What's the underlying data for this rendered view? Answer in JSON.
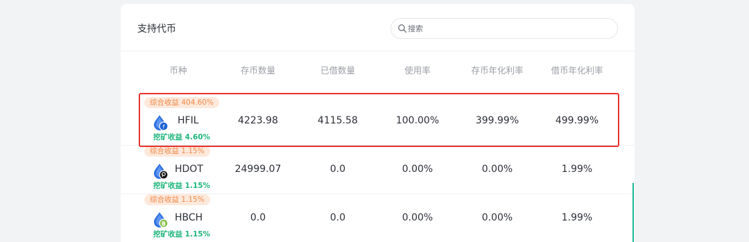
{
  "title": "支持代币",
  "search": {
    "placeholder": "搜索"
  },
  "table": {
    "headers": [
      "币种",
      "存币数量",
      "已借数量",
      "使用率",
      "存币年化利率",
      "借币年化利率"
    ],
    "rows": [
      {
        "total_yield": "综合收益 404.60%",
        "coin": "HFIL",
        "icon": "filecoin-icon",
        "mining_yield": "挖矿收益 4.60%",
        "deposited": "4223.98",
        "borrowed": "4115.58",
        "utilization": "100.00%",
        "deposit_apy": "399.99%",
        "borrow_apy": "499.99%"
      },
      {
        "total_yield": "综合收益 1.15%",
        "coin": "HDOT",
        "icon": "polkadot-icon",
        "mining_yield": "挖矿收益 1.15%",
        "deposited": "24999.07",
        "borrowed": "0.0",
        "utilization": "0.00%",
        "deposit_apy": "0.00%",
        "borrow_apy": "1.99%"
      },
      {
        "total_yield": "综合收益 1.15%",
        "coin": "HBCH",
        "icon": "bitcoin-cash-icon",
        "mining_yield": "挖矿收益 1.15%",
        "deposited": "0.0",
        "borrowed": "0.0",
        "utilization": "0.00%",
        "deposit_apy": "0.00%",
        "borrow_apy": "1.99%"
      }
    ]
  },
  "colors": {
    "highlight_border": "#e5322d",
    "total_yield_text": "#f08a4b",
    "mining_yield_text": "#1fb57b",
    "drop_blue": "#2f6fe0"
  }
}
